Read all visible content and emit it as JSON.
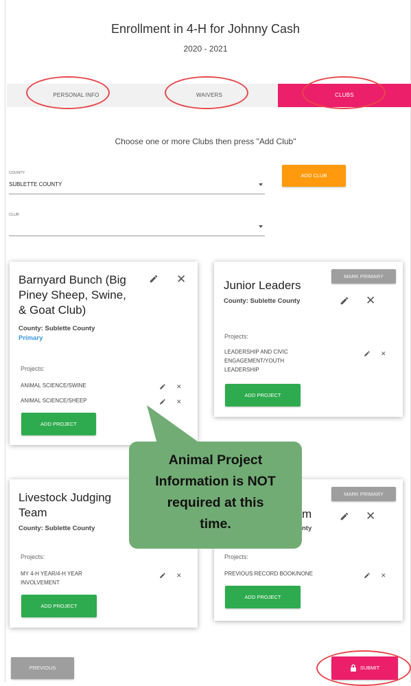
{
  "header": {
    "title": "Enrollment in 4-H for Johnny Cash",
    "years": "2020 - 2021"
  },
  "tabs": [
    {
      "label": "PERSONAL INFO",
      "active": false
    },
    {
      "label": "WAIVERS",
      "active": false
    },
    {
      "label": "CLUBS",
      "active": true
    }
  ],
  "instruction": "Choose one or more Clubs then press \"Add Club\"",
  "form": {
    "county_label": "COUNTY",
    "county_value": "SUBLETTE COUNTY",
    "club_label": "CLUB",
    "club_value": "",
    "add_club_label": "ADD CLUB"
  },
  "cards": [
    {
      "title_lines": [
        "Barnyard Bunch (Big",
        "Piney Sheep, Swine,",
        "& Goat Club)"
      ],
      "county": "County: Sublette County",
      "primary": "Primary",
      "projects_label": "Projects:",
      "projects": [
        "ANIMAL SCIENCE/SWINE",
        "ANIMAL SCIENCE/SHEEP"
      ],
      "add_project_label": "ADD PROJECT"
    },
    {
      "title_lines": [
        "Junior Leaders"
      ],
      "county": "County: Sublette County",
      "mark_primary_label": "MARK PRIMARY",
      "projects_label": "Projects:",
      "projects": [
        "LEADERSHIP AND CIVIC ENGAGEMENT/YOUTH LEADERSHIP"
      ],
      "project_lines": [
        "LEADERSHIP AND CIVIC",
        "ENGAGEMENT/YOUTH",
        "LEADERSHIP"
      ],
      "add_project_label": "ADD PROJECT"
    },
    {
      "title_lines": [
        "Livestock Judging",
        "Team"
      ],
      "county": "County: Sublette County",
      "projects_label": "Projects:",
      "projects": [
        "MY 4-H YEAR/4-H YEAR INVOLVEMENT"
      ],
      "project_lines": [
        "MY 4-H YEAR/4-H YEAR",
        "INVOLVEMENT"
      ],
      "add_project_label": "ADD PROJECT"
    },
    {
      "title_visible": "m",
      "county_visible": "nty",
      "mark_primary_label": "MARK PRIMARY",
      "projects_label": "Projects:",
      "projects": [
        "PREVIOUS RECORD BOOK/NONE"
      ],
      "add_project_label": "ADD PROJECT"
    }
  ],
  "callout": {
    "lines": [
      "Animal Project",
      "Information is NOT",
      "required at this",
      "time."
    ],
    "color": "#72ac75"
  },
  "footer": {
    "previous_label": "PREVIOUS",
    "submit_label": "SUBMIT"
  },
  "colors": {
    "accent": "#ec1f6a",
    "add_club": "#ff9a0e",
    "add_project": "#2eab4e",
    "annotation_circle": "#e8474c",
    "primary_text": "#3a96e0"
  },
  "icons": {
    "edit": "pencil-icon",
    "remove": "close-icon",
    "submit": "lock-icon",
    "dropdown": "caret-down-icon"
  }
}
